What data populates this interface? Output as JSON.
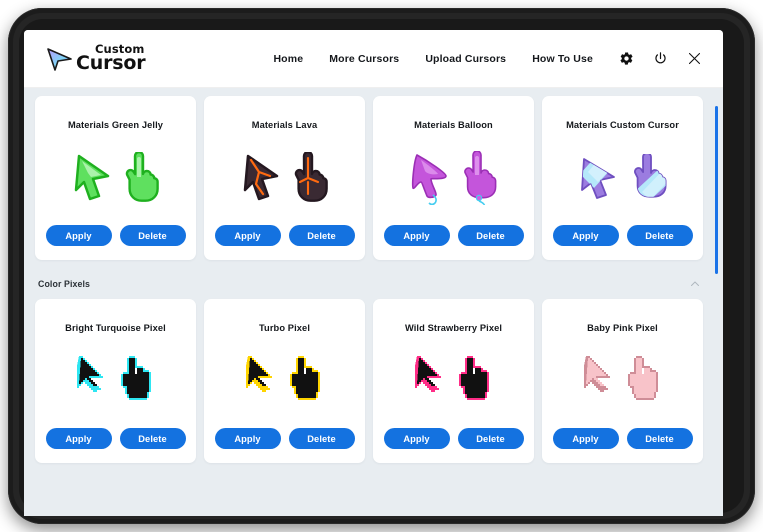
{
  "header": {
    "logo": {
      "top_word": "Custom",
      "bottom_word": "Cursor",
      "mark": "cursor-arrow-icon"
    },
    "nav_links": [
      {
        "label": "Home",
        "name": "nav-home"
      },
      {
        "label": "More Cursors",
        "name": "nav-more-cursors"
      },
      {
        "label": "Upload Cursors",
        "name": "nav-upload-cursors"
      },
      {
        "label": "How To Use",
        "name": "nav-how-to-use"
      }
    ],
    "icons": [
      {
        "name": "gear-icon",
        "label": "Settings"
      },
      {
        "name": "power-icon",
        "label": "Power"
      },
      {
        "name": "close-icon",
        "label": "Close"
      }
    ]
  },
  "buttons": {
    "apply_label": "Apply",
    "delete_label": "Delete"
  },
  "sections": [
    {
      "name": "materials-section",
      "title": null,
      "cards": [
        {
          "title": "Materials Green Jelly",
          "art": "green-jelly-cursor"
        },
        {
          "title": "Materials Lava",
          "art": "lava-cursor"
        },
        {
          "title": "Materials Balloon",
          "art": "balloon-cursor"
        },
        {
          "title": "Materials Custom Cursor",
          "art": "custom-cursor-cursor"
        }
      ]
    },
    {
      "name": "color-pixels-section",
      "title": "Color Pixels",
      "collapse_icon": "chevron-up-icon",
      "cards": [
        {
          "title": "Bright Turquoise Pixel",
          "art": "pixel-cursor-turquoise"
        },
        {
          "title": "Turbo Pixel",
          "art": "pixel-cursor-yellow"
        },
        {
          "title": "Wild Strawberry Pixel",
          "art": "pixel-cursor-pink"
        },
        {
          "title": "Baby Pink Pixel",
          "art": "pixel-cursor-babypink"
        }
      ]
    }
  ],
  "colors": {
    "button_blue": "#1472e0",
    "page_background": "#e8edf1",
    "card_background": "#ffffff",
    "scrollbar_thumb": "#1a73e8",
    "bezel": "#1c1c1c",
    "turquoise": "#2ee6f2",
    "turbo_yellow": "#ffd500",
    "wild_strawberry": "#ff3399",
    "baby_pink": "#f6bdc4",
    "green_jelly": "#4ddb4d",
    "lava": "#ff6600",
    "balloon_purple": "#cc55dd",
    "custom_purple": "#a07ae0"
  },
  "scrollbar": {
    "name": "vertical-scrollbar"
  }
}
